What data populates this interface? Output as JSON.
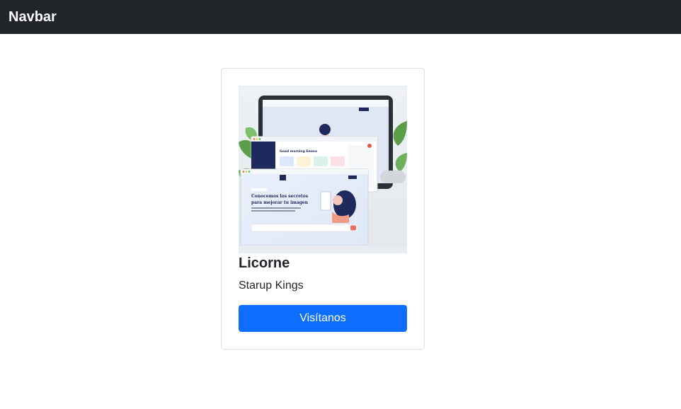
{
  "navbar": {
    "brand": "Navbar"
  },
  "card": {
    "image": {
      "window_text": {
        "headline_line1": "Conocemos los secretos",
        "headline_line2": "para mejorar tu imagen",
        "dashboard_title": "Good morning Emma"
      }
    },
    "title": "Licorne",
    "text": "Starup Kings",
    "button_label": "Visítanos"
  },
  "colors": {
    "navbar_bg": "#212529",
    "button_bg": "#0d6efd",
    "border": "#dee2e6"
  }
}
